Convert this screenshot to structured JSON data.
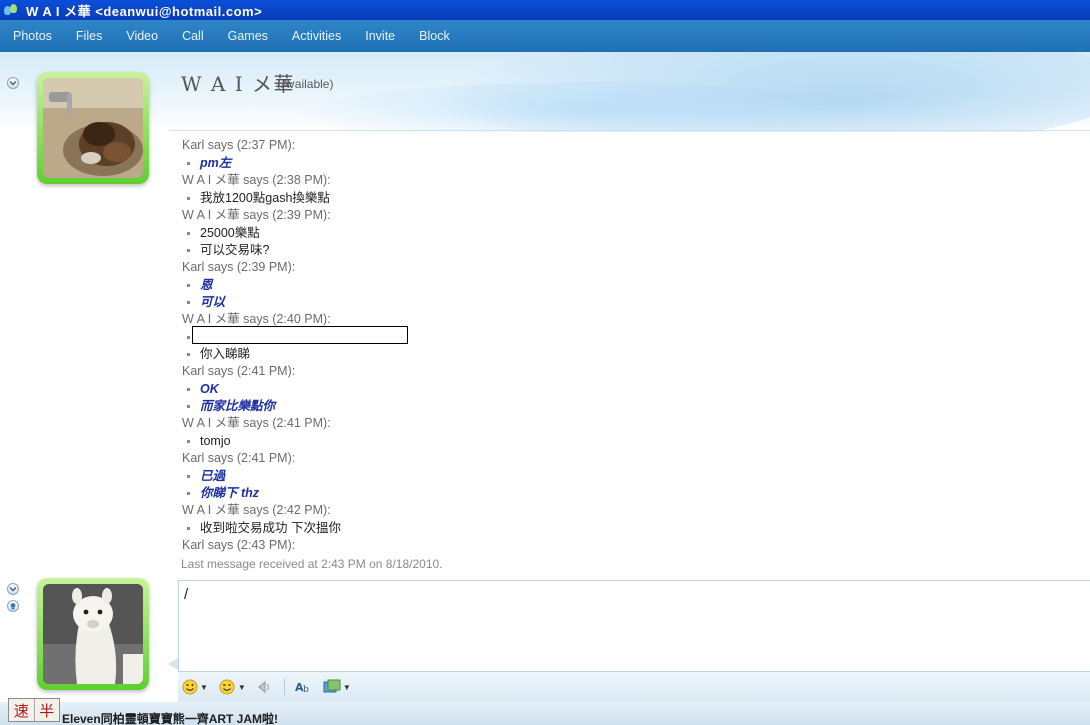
{
  "window": {
    "title": "W A I メ華 <deanwui@hotmail.com>"
  },
  "menu": {
    "items": [
      "Photos",
      "Files",
      "Video",
      "Call",
      "Games",
      "Activities",
      "Invite",
      "Block"
    ]
  },
  "contact": {
    "name": "W A I メ華",
    "status": "(Available)"
  },
  "conversation": [
    {
      "speaker": "karl",
      "header": "Karl says (2:37 PM):",
      "lines": [
        "pm左"
      ]
    },
    {
      "speaker": "wai",
      "header": "W A I メ華 says (2:38 PM):",
      "lines": [
        "我放1200點gash換樂點"
      ]
    },
    {
      "speaker": "wai",
      "header": "W A I メ華 says (2:39 PM):",
      "lines": [
        "25000樂點",
        "可以交易味?"
      ]
    },
    {
      "speaker": "karl",
      "header": "Karl says (2:39 PM):",
      "lines": [
        "恩",
        "可以"
      ]
    },
    {
      "speaker": "wai",
      "header": "W A I メ華 says (2:40 PM):",
      "lines": [
        "",
        "你入睇睇"
      ]
    },
    {
      "speaker": "karl",
      "header": "Karl says (2:41 PM):",
      "lines": [
        "OK",
        "而家比樂點你"
      ]
    },
    {
      "speaker": "wai",
      "header": "W A I メ華 says (2:41 PM):",
      "lines": [
        "tomjo"
      ]
    },
    {
      "speaker": "karl",
      "header": "Karl says (2:41 PM):",
      "lines": [
        "已過",
        "你睇下 thz"
      ]
    },
    {
      "speaker": "wai",
      "header": "W A I メ華 says (2:42 PM):",
      "lines": [
        "收到啦交易成功 下次搵你"
      ]
    },
    {
      "speaker": "karl",
      "header": "Karl says (2:43 PM):",
      "lines": []
    }
  ],
  "last_message": "Last message received at 2:43 PM on 8/18/2010.",
  "input": {
    "value": "/"
  },
  "ime": {
    "left": "速",
    "right": "半"
  },
  "bottom_ad": "Eleven同柏靈頓寶寶熊一齊ART JAM啦!",
  "colors": {
    "menubar": "#1f6fb4",
    "karl_text": "#1c2fa3",
    "avatar_frame": "#5fcf2f"
  }
}
